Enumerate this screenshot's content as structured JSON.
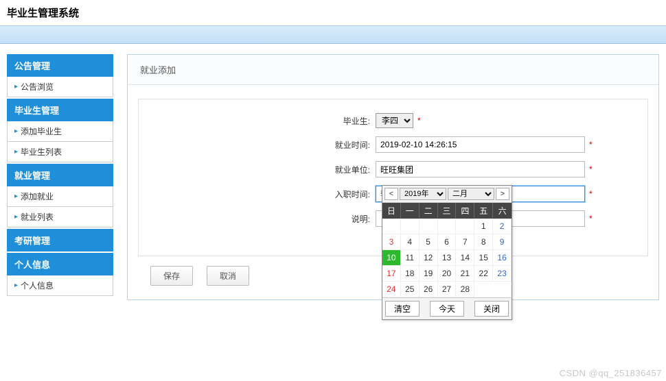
{
  "header": {
    "title": "毕业生管理系统"
  },
  "sidebar": {
    "sections": [
      {
        "header": "公告管理",
        "items": [
          {
            "label": "公告浏览"
          }
        ]
      },
      {
        "header": "毕业生管理",
        "items": [
          {
            "label": "添加毕业生"
          },
          {
            "label": "毕业生列表"
          }
        ]
      },
      {
        "header": "就业管理",
        "items": [
          {
            "label": "添加就业"
          },
          {
            "label": "就业列表"
          }
        ]
      },
      {
        "header": "考研管理",
        "items": []
      },
      {
        "header": "个人信息",
        "items": [
          {
            "label": "个人信息"
          }
        ]
      }
    ]
  },
  "panel": {
    "title": "就业添加"
  },
  "form": {
    "graduate_label": "毕业生:",
    "graduate_value": "李四",
    "jobtime_label": "就业时间:",
    "jobtime_value": "2019-02-10 14:26:15",
    "company_label": "就业单位:",
    "company_value": "旺旺集团",
    "hiretime_label": "入职时间:",
    "hiretime_placeholder": "输入入职时间",
    "hiretime_value": "",
    "desc_label": "说明:",
    "desc_value": ""
  },
  "buttons": {
    "save": "保存",
    "cancel": "取消"
  },
  "datepicker": {
    "prev": "<",
    "next": ">",
    "year": "2019年",
    "month": "二月",
    "weekdays": [
      "日",
      "一",
      "二",
      "三",
      "四",
      "五",
      "六"
    ],
    "leading_blanks": 5,
    "days": 28,
    "today": 10,
    "clear": "清空",
    "today_btn": "今天",
    "close": "关闭"
  },
  "watermark": "CSDN @qq_251836457"
}
